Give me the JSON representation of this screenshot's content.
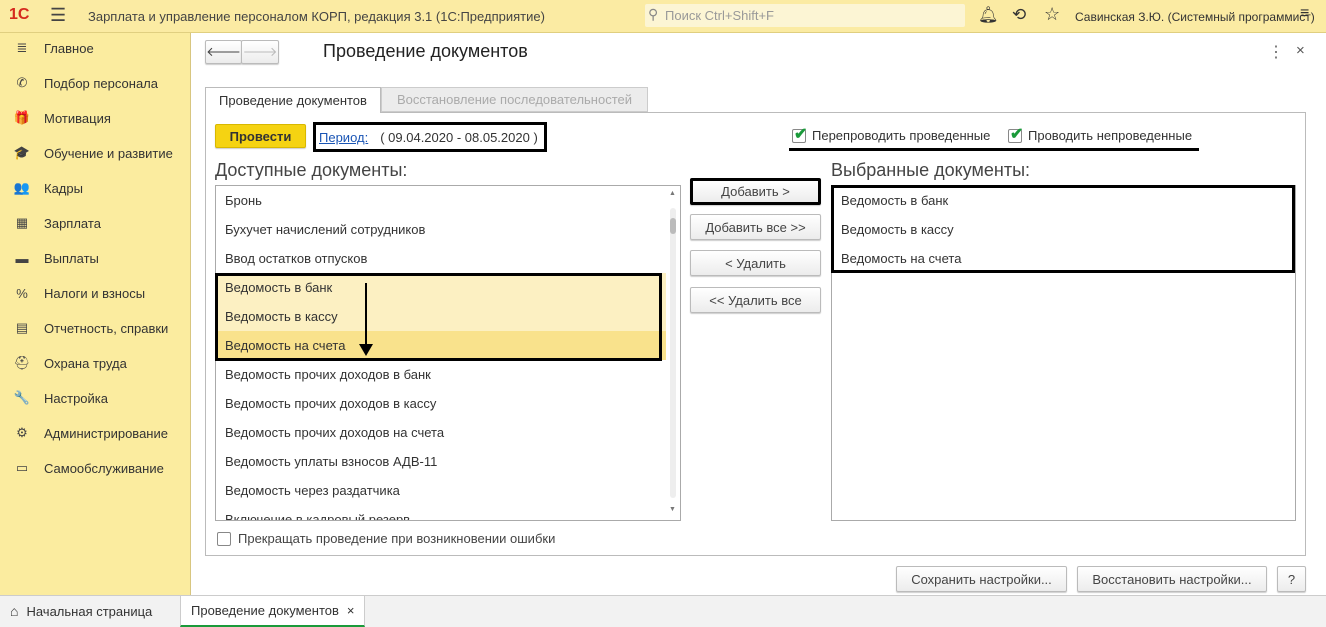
{
  "app": {
    "logo": "1С",
    "title": "Зарплата и управление персоналом КОРП, редакция 3.1   (1С:Предприятие)",
    "search_placeholder": "Поиск Ctrl+Shift+F",
    "user": "Савинская З.Ю. (Системный программист)"
  },
  "sidebar": {
    "items": [
      {
        "label": "Главное",
        "icon": "≣"
      },
      {
        "label": "Подбор персонала",
        "icon": "✆"
      },
      {
        "label": "Мотивация",
        "icon": "🎁"
      },
      {
        "label": "Обучение и развитие",
        "icon": "🎓"
      },
      {
        "label": "Кадры",
        "icon": "👥"
      },
      {
        "label": "Зарплата",
        "icon": "▦"
      },
      {
        "label": "Выплаты",
        "icon": "▬"
      },
      {
        "label": "Налоги и взносы",
        "icon": "%"
      },
      {
        "label": "Отчетность, справки",
        "icon": "▤"
      },
      {
        "label": "Охрана труда",
        "icon": "⛑"
      },
      {
        "label": "Настройка",
        "icon": "🔧"
      },
      {
        "label": "Администрирование",
        "icon": "⚙"
      },
      {
        "label": "Самообслуживание",
        "icon": "▭"
      }
    ]
  },
  "form": {
    "title": "Проведение документов",
    "tabs": [
      {
        "label": "Проведение документов",
        "active": true
      },
      {
        "label": "Восстановление последовательностей",
        "active": false
      }
    ],
    "post_button": "Провести",
    "period_link": "Период:",
    "period_value": "( 09.04.2020 - 08.05.2020 )",
    "repost_label": "Перепроводить проведенные",
    "repost_checked": true,
    "post_unposted_label": "Проводить непроведенные",
    "post_unposted_checked": true,
    "available_title": "Доступные документы:",
    "selected_title": "Выбранные документы:",
    "available": [
      "Бронь",
      "Бухучет начислений сотрудников",
      "Ввод остатков отпусков",
      "Ведомость в банк",
      "Ведомость в кассу",
      "Ведомость на счета",
      "Ведомость прочих доходов в банк",
      "Ведомость прочих доходов в кассу",
      "Ведомость прочих доходов на счета",
      "Ведомость уплаты взносов АДВ-11",
      "Ведомость через раздатчика",
      "Включение в кадровый резерв"
    ],
    "selected": [
      "Ведомость в банк",
      "Ведомость в кассу",
      "Ведомость на счета"
    ],
    "add": "Добавить >",
    "add_all": "Добавить все >>",
    "remove": "< Удалить",
    "remove_all": "<< Удалить все",
    "stop_on_error": "Прекращать проведение при возникновении ошибки",
    "stop_on_error_checked": false,
    "save_settings": "Сохранить настройки...",
    "restore_settings": "Восстановить настройки...",
    "help": "?"
  },
  "bottom_tabs": [
    {
      "label": "Начальная страница"
    },
    {
      "label": "Проведение документов",
      "close": "×"
    }
  ],
  "colors": {
    "accent_yellow": "#f5d312",
    "sidebar": "#fbec9f",
    "highlight": "#fcf0c2",
    "selected_row": "#f9e28c",
    "check": "#1a9a3a"
  }
}
